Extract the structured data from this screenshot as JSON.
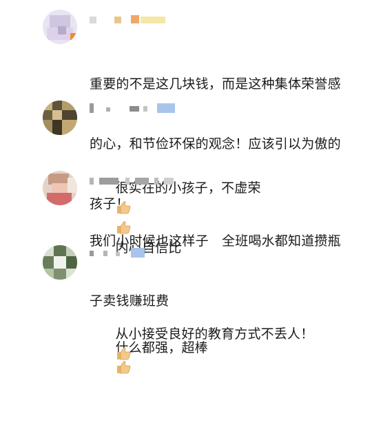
{
  "comments": [
    {
      "text_lines": [
        "重要的不是这几块钱，而是这种集体荣誉感",
        "的心，和节俭环保的观念！应该引以为傲的",
        "孩子！"
      ]
    },
    {
      "text_line1_a": "很实在的小孩子，不虚荣",
      "text_line1_b": "内心自信比",
      "text_line2_a": "什么都强，超棒",
      "emojis": [
        "thumbs-up-icon",
        "thumbs-up-icon",
        "thumbs-up-icon"
      ]
    },
    {
      "text_lines": [
        "我们小时候也这样子　全班喝水都知道攒瓶",
        "子卖钱赚班费"
      ]
    },
    {
      "text_a": "从小接受良好的教育方式不丢人！",
      "emojis": [
        "thumbs-up-icon"
      ]
    }
  ],
  "colors": {
    "text": "#1a1a1a",
    "username_mosaic": "#cfcfcf",
    "badge_mosaic": "#a9c4ec",
    "thumb_skin": "#f3c98b",
    "thumb_edge": "#d59a4c"
  }
}
